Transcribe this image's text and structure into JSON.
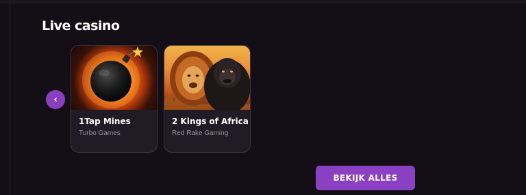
{
  "section": {
    "title": "Live casino"
  },
  "carousel": {
    "prev_label": "‹",
    "games": [
      {
        "title": "1Tap Mines",
        "provider": "Turbo Games",
        "thumb_icon": "bomb-explosion-art"
      },
      {
        "title": "2 Kings of Africa",
        "provider": "Red Rake Gaming",
        "thumb_icon": "lion-and-gorilla-art"
      }
    ]
  },
  "actions": {
    "view_all_label": "BEKIJK ALLES"
  },
  "colors": {
    "background": "#140f16",
    "card": "#211b25",
    "accent": "#8b3fc2",
    "provider_text": "#9a8ea3"
  }
}
